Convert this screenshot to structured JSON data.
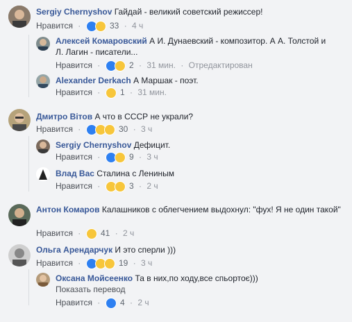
{
  "comments": [
    {
      "name": "Sergiy Chernyshov",
      "text": "Гайдай - великий советский режиссер!",
      "like": "Нравится",
      "count": "33",
      "time": "4 ч"
    },
    {
      "name": "Алексей Комаровский",
      "text": "А И. Дунаевский - композитор. А А. Толстой и Л. Лагин - писатели...",
      "like": "Нравится",
      "count": "2",
      "time": "31 мин.",
      "edited": "Отредактирован"
    },
    {
      "name": "Alexander Derkach",
      "text": "А Маршак - поэт.",
      "like": "Нравится",
      "count": "1",
      "time": "31 мин."
    },
    {
      "name": "Дмитро Вітов",
      "text": "А что в СССР не украли?",
      "like": "Нравится",
      "count": "30",
      "time": "3 ч"
    },
    {
      "name": "Sergiy Chernyshov",
      "text": "Дефицит.",
      "like": "Нравится",
      "count": "9",
      "time": "3 ч"
    },
    {
      "name": "Влад Вас",
      "text": "Сталина с Лениным",
      "like": "Нравится",
      "count": "3",
      "time": "2 ч"
    },
    {
      "name": "Антон Комаров",
      "text": "Калашников с облегчением выдохнул: \"фух! Я не один такой\"",
      "like": "Нравится",
      "count": "41",
      "time": "2 ч"
    },
    {
      "name": "Ольга Арендарчук",
      "text": "И это сперли )))",
      "like": "Нравится",
      "count": "19",
      "time": "3 ч"
    },
    {
      "name": "Оксана Мойсеенко",
      "text": "Та в них,по ходу,все спьортоє)))",
      "like": "Нравится",
      "count": "4",
      "time": "2 ч",
      "translate": "Показать перевод"
    }
  ],
  "colors": {
    "link": "#385898",
    "like_blue": "#2e80f1",
    "emoji_yellow": "#f7c63b",
    "background": "#f2f3f5"
  }
}
